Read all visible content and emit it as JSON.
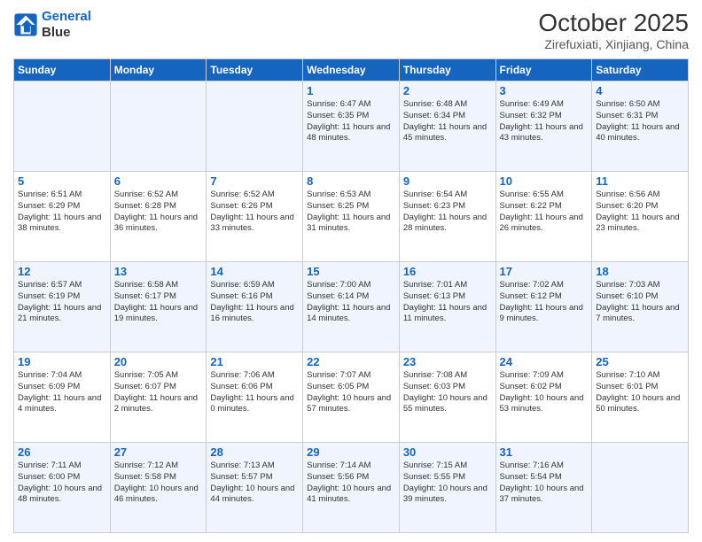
{
  "header": {
    "logo_line1": "General",
    "logo_line2": "Blue",
    "month": "October 2025",
    "location": "Zirefuxiati, Xinjiang, China"
  },
  "days_of_week": [
    "Sunday",
    "Monday",
    "Tuesday",
    "Wednesday",
    "Thursday",
    "Friday",
    "Saturday"
  ],
  "weeks": [
    [
      {
        "day": "",
        "text": ""
      },
      {
        "day": "",
        "text": ""
      },
      {
        "day": "",
        "text": ""
      },
      {
        "day": "1",
        "text": "Sunrise: 6:47 AM\nSunset: 6:35 PM\nDaylight: 11 hours and 48 minutes."
      },
      {
        "day": "2",
        "text": "Sunrise: 6:48 AM\nSunset: 6:34 PM\nDaylight: 11 hours and 45 minutes."
      },
      {
        "day": "3",
        "text": "Sunrise: 6:49 AM\nSunset: 6:32 PM\nDaylight: 11 hours and 43 minutes."
      },
      {
        "day": "4",
        "text": "Sunrise: 6:50 AM\nSunset: 6:31 PM\nDaylight: 11 hours and 40 minutes."
      }
    ],
    [
      {
        "day": "5",
        "text": "Sunrise: 6:51 AM\nSunset: 6:29 PM\nDaylight: 11 hours and 38 minutes."
      },
      {
        "day": "6",
        "text": "Sunrise: 6:52 AM\nSunset: 6:28 PM\nDaylight: 11 hours and 36 minutes."
      },
      {
        "day": "7",
        "text": "Sunrise: 6:52 AM\nSunset: 6:26 PM\nDaylight: 11 hours and 33 minutes."
      },
      {
        "day": "8",
        "text": "Sunrise: 6:53 AM\nSunset: 6:25 PM\nDaylight: 11 hours and 31 minutes."
      },
      {
        "day": "9",
        "text": "Sunrise: 6:54 AM\nSunset: 6:23 PM\nDaylight: 11 hours and 28 minutes."
      },
      {
        "day": "10",
        "text": "Sunrise: 6:55 AM\nSunset: 6:22 PM\nDaylight: 11 hours and 26 minutes."
      },
      {
        "day": "11",
        "text": "Sunrise: 6:56 AM\nSunset: 6:20 PM\nDaylight: 11 hours and 23 minutes."
      }
    ],
    [
      {
        "day": "12",
        "text": "Sunrise: 6:57 AM\nSunset: 6:19 PM\nDaylight: 11 hours and 21 minutes."
      },
      {
        "day": "13",
        "text": "Sunrise: 6:58 AM\nSunset: 6:17 PM\nDaylight: 11 hours and 19 minutes."
      },
      {
        "day": "14",
        "text": "Sunrise: 6:59 AM\nSunset: 6:16 PM\nDaylight: 11 hours and 16 minutes."
      },
      {
        "day": "15",
        "text": "Sunrise: 7:00 AM\nSunset: 6:14 PM\nDaylight: 11 hours and 14 minutes."
      },
      {
        "day": "16",
        "text": "Sunrise: 7:01 AM\nSunset: 6:13 PM\nDaylight: 11 hours and 11 minutes."
      },
      {
        "day": "17",
        "text": "Sunrise: 7:02 AM\nSunset: 6:12 PM\nDaylight: 11 hours and 9 minutes."
      },
      {
        "day": "18",
        "text": "Sunrise: 7:03 AM\nSunset: 6:10 PM\nDaylight: 11 hours and 7 minutes."
      }
    ],
    [
      {
        "day": "19",
        "text": "Sunrise: 7:04 AM\nSunset: 6:09 PM\nDaylight: 11 hours and 4 minutes."
      },
      {
        "day": "20",
        "text": "Sunrise: 7:05 AM\nSunset: 6:07 PM\nDaylight: 11 hours and 2 minutes."
      },
      {
        "day": "21",
        "text": "Sunrise: 7:06 AM\nSunset: 6:06 PM\nDaylight: 11 hours and 0 minutes."
      },
      {
        "day": "22",
        "text": "Sunrise: 7:07 AM\nSunset: 6:05 PM\nDaylight: 10 hours and 57 minutes."
      },
      {
        "day": "23",
        "text": "Sunrise: 7:08 AM\nSunset: 6:03 PM\nDaylight: 10 hours and 55 minutes."
      },
      {
        "day": "24",
        "text": "Sunrise: 7:09 AM\nSunset: 6:02 PM\nDaylight: 10 hours and 53 minutes."
      },
      {
        "day": "25",
        "text": "Sunrise: 7:10 AM\nSunset: 6:01 PM\nDaylight: 10 hours and 50 minutes."
      }
    ],
    [
      {
        "day": "26",
        "text": "Sunrise: 7:11 AM\nSunset: 6:00 PM\nDaylight: 10 hours and 48 minutes."
      },
      {
        "day": "27",
        "text": "Sunrise: 7:12 AM\nSunset: 5:58 PM\nDaylight: 10 hours and 46 minutes."
      },
      {
        "day": "28",
        "text": "Sunrise: 7:13 AM\nSunset: 5:57 PM\nDaylight: 10 hours and 44 minutes."
      },
      {
        "day": "29",
        "text": "Sunrise: 7:14 AM\nSunset: 5:56 PM\nDaylight: 10 hours and 41 minutes."
      },
      {
        "day": "30",
        "text": "Sunrise: 7:15 AM\nSunset: 5:55 PM\nDaylight: 10 hours and 39 minutes."
      },
      {
        "day": "31",
        "text": "Sunrise: 7:16 AM\nSunset: 5:54 PM\nDaylight: 10 hours and 37 minutes."
      },
      {
        "day": "",
        "text": ""
      }
    ]
  ]
}
